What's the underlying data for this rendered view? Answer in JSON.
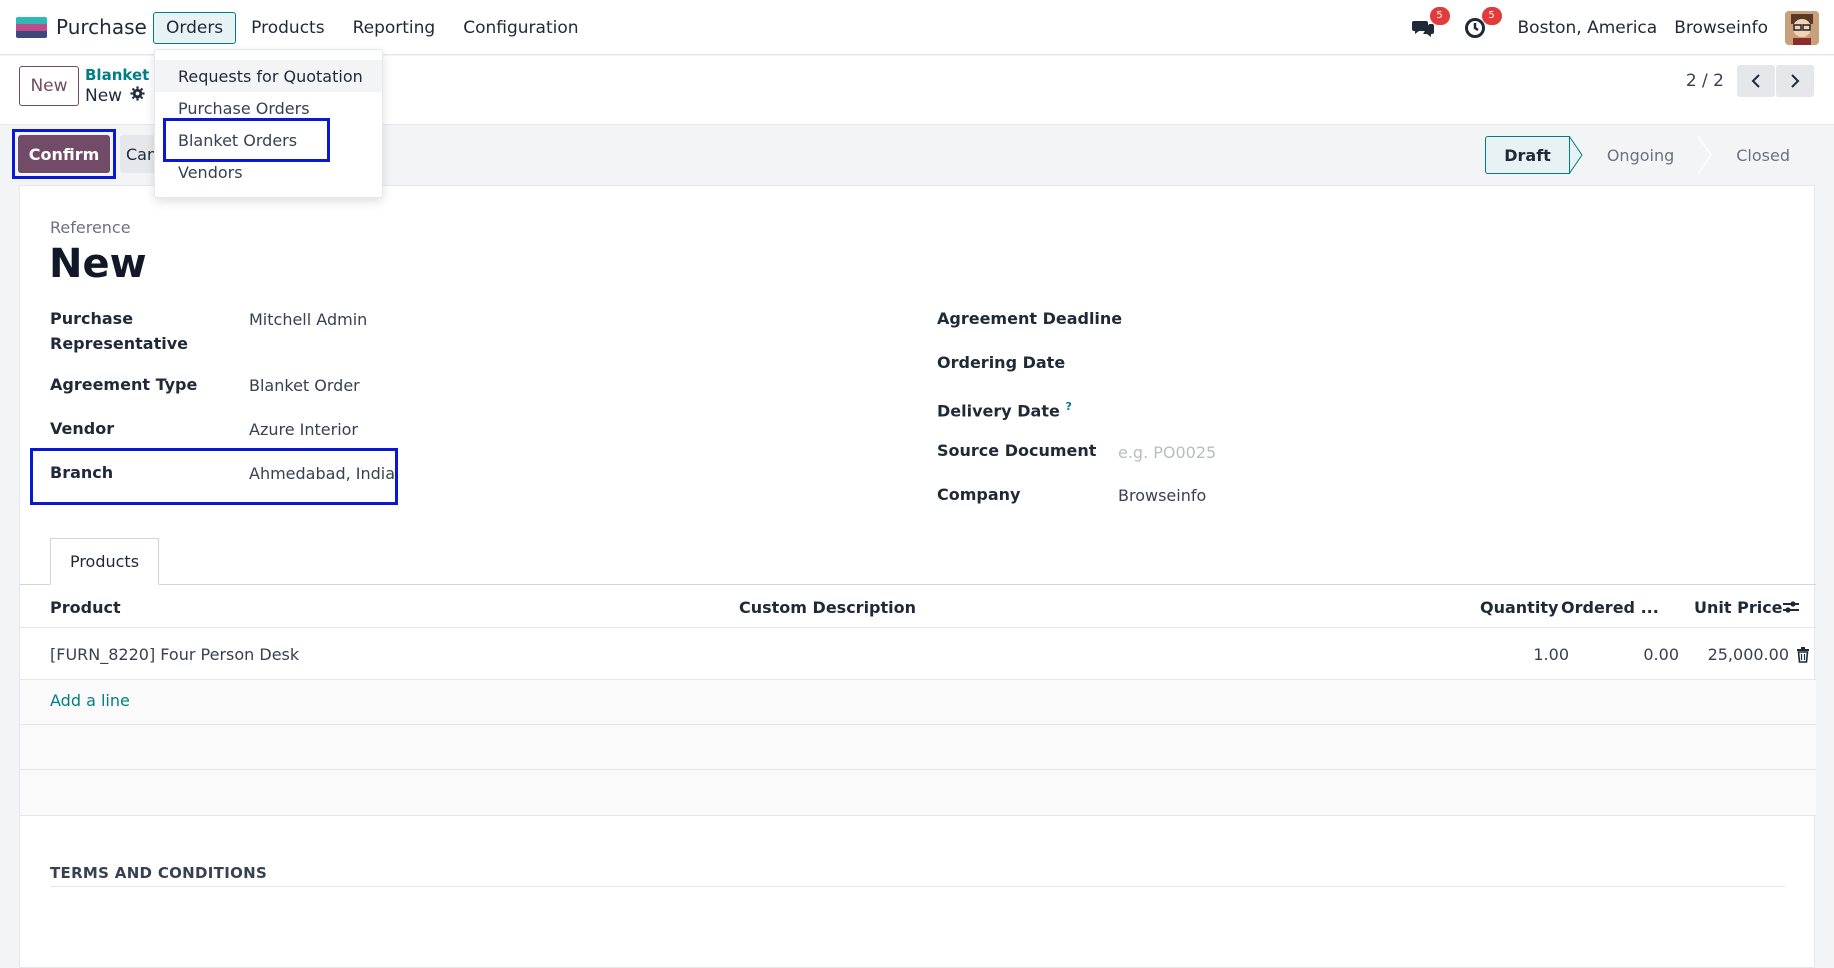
{
  "navbar": {
    "app_name": "Purchase",
    "menu": [
      "Orders",
      "Products",
      "Reporting",
      "Configuration"
    ],
    "messages_badge": "5",
    "activities_badge": "5",
    "location": "Boston, America",
    "company": "Browseinfo"
  },
  "orders_menu": {
    "items": [
      "Requests for Quotation",
      "Purchase Orders",
      "Blanket Orders",
      "Vendors"
    ]
  },
  "control": {
    "new_label": "New",
    "breadcrumb": "Blanket C",
    "record_name": "New",
    "pager": "2 / 2"
  },
  "actions": {
    "confirm_label": "Confirm",
    "cancel_label": "Can"
  },
  "status": {
    "stages": [
      "Draft",
      "Ongoing",
      "Closed"
    ],
    "current": "Draft"
  },
  "form": {
    "reference_label": "Reference",
    "reference_value": "New",
    "left_fields": [
      {
        "label": "Purchase Representative",
        "value": "Mitchell Admin"
      },
      {
        "label": "Agreement Type",
        "value": "Blanket Order"
      },
      {
        "label": "Vendor",
        "value": "Azure Interior"
      },
      {
        "label": "Branch",
        "value": "Ahmedabad, India"
      }
    ],
    "right_fields": [
      {
        "label": "Agreement Deadline",
        "value": ""
      },
      {
        "label": "Ordering Date",
        "value": ""
      },
      {
        "label": "Delivery Date",
        "value": ""
      },
      {
        "label": "Source Document",
        "value": "",
        "placeholder": "e.g. PO0025"
      },
      {
        "label": "Company",
        "value": "Browseinfo"
      }
    ],
    "delivery_help": "?"
  },
  "tabs": [
    "Products"
  ],
  "lines_table": {
    "headers": [
      "Product",
      "Custom Description",
      "Quantity",
      "Ordered ...",
      "Unit Price"
    ],
    "rows": [
      {
        "product": "[FURN_8220] Four Person Desk",
        "description": "",
        "quantity": "1.00",
        "ordered": "0.00",
        "unit_price": "25,000.00"
      }
    ],
    "add_line": "Add a line"
  },
  "terms_title": "TERMS AND CONDITIONS",
  "colors": {
    "primary": "#714b67",
    "accent": "#017e84",
    "highlight": "#0a18d6"
  }
}
